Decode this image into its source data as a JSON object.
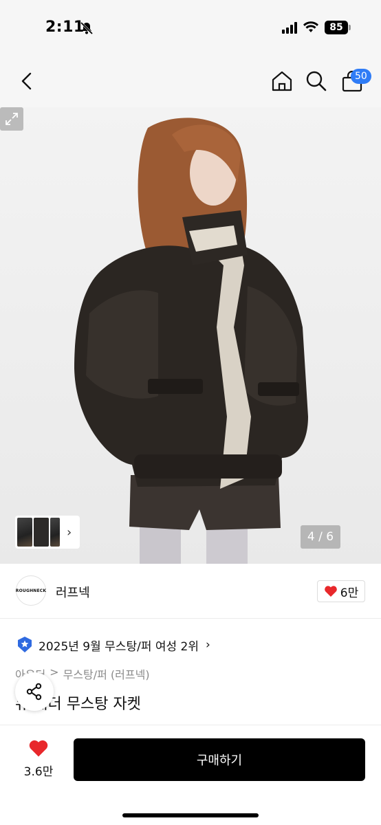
{
  "status": {
    "time": "2:11",
    "battery": "85"
  },
  "nav": {
    "cart_count": "50"
  },
  "gallery": {
    "page_counter": "4 / 6"
  },
  "brand": {
    "logo_text": "ROUGHNECK",
    "name": "러프넥",
    "likes": "6만"
  },
  "ranking": {
    "text": "2025년 9월 무스탕/퍼 여성 2위"
  },
  "category": {
    "parent": "아우터",
    "child": "무스탕/퍼 (러프넥)",
    "separator": ">"
  },
  "product": {
    "title": "레더 무스탕 자켓",
    "title_prefix": "뉴"
  },
  "bottom": {
    "wish_count": "3.6만",
    "buy_label": "구매하기"
  },
  "colors": {
    "accent_blue": "#2f7cf6",
    "heart_red": "#e8282b",
    "buy_button": "#000000"
  },
  "icons": [
    "back-icon",
    "home-icon",
    "search-icon",
    "cart-icon",
    "heart-icon",
    "share-icon",
    "expand-icon",
    "rank-badge-icon"
  ]
}
